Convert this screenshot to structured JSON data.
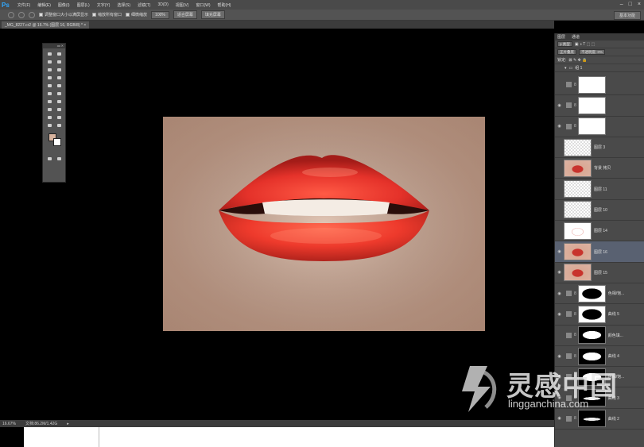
{
  "app": {
    "logo": "Ps"
  },
  "menu": [
    "文件(F)",
    "编辑(E)",
    "图像(I)",
    "图层(L)",
    "文字(Y)",
    "选择(S)",
    "滤镜(T)",
    "3D(D)",
    "视图(V)",
    "窗口(W)",
    "帮助(H)"
  ],
  "window_controls": [
    "–",
    "□",
    "×"
  ],
  "options_bar": {
    "check1": "调整窗口大小以满屏显示",
    "check2": "缩放所有窗口",
    "check3": "细微缩放",
    "btn_100": "100%",
    "btn_fit": "适合屏幕",
    "btn_fill": "填充屏幕",
    "workspace": "基本功能"
  },
  "document_tab": "_MG_8227.cr2 @ 16.7% (图层 16, RGB/8) * ×",
  "status": {
    "zoom": "16.67%",
    "doc": "文档:86.2M/1.42G"
  },
  "panel": {
    "tabs": [
      "图层",
      "通道"
    ],
    "kind_filter": "ρ 类型",
    "blend_mode": "正片叠底",
    "opacity": "不透明度: 0%",
    "lock_label": "锁定:",
    "group_label": "组 1"
  },
  "layers": [
    {
      "name": "",
      "thumb": "white",
      "eye": false
    },
    {
      "name": "",
      "thumb": "white",
      "eye": true
    },
    {
      "name": "",
      "thumb": "white",
      "eye": true
    },
    {
      "name": "图层 3",
      "thumb": "check",
      "eye": false
    },
    {
      "name": "背景 拷贝",
      "thumb": "lips",
      "eye": false
    },
    {
      "name": "图层 11",
      "thumb": "check",
      "eye": false
    },
    {
      "name": "图层 10",
      "thumb": "check",
      "eye": false
    },
    {
      "name": "图层 14",
      "thumb": "outline",
      "eye": false
    },
    {
      "name": "图层 16",
      "thumb": "lips",
      "eye": true,
      "selected": true
    },
    {
      "name": "图层 15",
      "thumb": "lips",
      "eye": true
    },
    {
      "name": "色相/饱...",
      "thumb": "mask-black-lips",
      "eye": true
    },
    {
      "name": "曲线 5",
      "thumb": "mask-black-lips",
      "eye": true
    },
    {
      "name": "颜色填...",
      "thumb": "mask-white-lips",
      "eye": false
    },
    {
      "name": "曲线 4",
      "thumb": "mask-white-lips",
      "eye": true
    },
    {
      "name": "色相/饱...",
      "thumb": "mask-white-lips",
      "eye": true
    },
    {
      "name": "曲线 3",
      "thumb": "mask-thin",
      "eye": true
    },
    {
      "name": "曲线 2",
      "thumb": "mask-thin",
      "eye": true
    }
  ],
  "watermark": {
    "title": "灵感中国",
    "subtitle": "lingganchina.com"
  },
  "colors": {
    "lip": "#e5322a",
    "skin": "#d9b8a6",
    "accent": "#31a8ff",
    "purple": "#9c3adf"
  }
}
